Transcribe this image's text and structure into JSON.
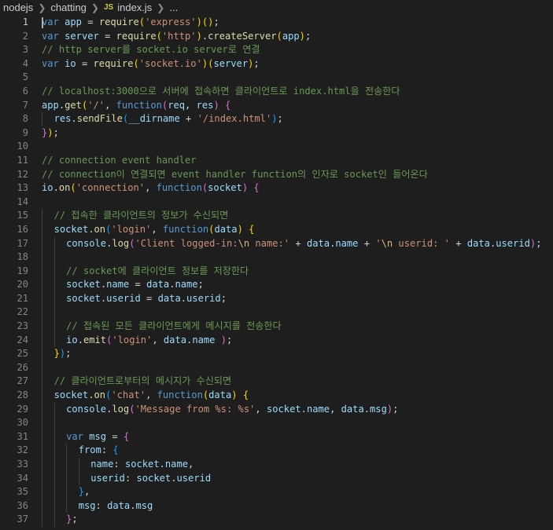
{
  "breadcrumb": {
    "items": [
      "nodejs",
      "chatting",
      "index.js",
      "..."
    ],
    "js_icon": "JS"
  },
  "colors": {
    "background": "#1e1e1e",
    "keyword": "#569cd6",
    "variable": "#9cdcfe",
    "function": "#dcdcaa",
    "string": "#ce9178",
    "comment": "#6a9955"
  },
  "editor": {
    "lines": [
      {
        "n": "1",
        "t": [
          [
            "k",
            "var"
          ],
          [
            "p",
            " "
          ],
          [
            "v",
            "app"
          ],
          [
            "p",
            " = "
          ],
          [
            "f",
            "require"
          ],
          [
            "bg",
            "("
          ],
          [
            "s",
            "'express'"
          ],
          [
            "bg",
            ")"
          ],
          [
            "bg",
            "("
          ],
          [
            "bg",
            ")"
          ],
          [
            "p",
            ";"
          ]
        ]
      },
      {
        "n": "2",
        "t": [
          [
            "k",
            "var"
          ],
          [
            "p",
            " "
          ],
          [
            "v",
            "server"
          ],
          [
            "p",
            " = "
          ],
          [
            "f",
            "require"
          ],
          [
            "bg",
            "("
          ],
          [
            "s",
            "'http'"
          ],
          [
            "bg",
            ")"
          ],
          [
            "p",
            "."
          ],
          [
            "f",
            "createServer"
          ],
          [
            "bg",
            "("
          ],
          [
            "v",
            "app"
          ],
          [
            "bg",
            ")"
          ],
          [
            "p",
            ";"
          ]
        ]
      },
      {
        "n": "3",
        "t": [
          [
            "c",
            "// http server를 socket.io server로 연결"
          ]
        ]
      },
      {
        "n": "4",
        "t": [
          [
            "k",
            "var"
          ],
          [
            "p",
            " "
          ],
          [
            "v",
            "io"
          ],
          [
            "p",
            " = "
          ],
          [
            "f",
            "require"
          ],
          [
            "bg",
            "("
          ],
          [
            "s",
            "'socket.io'"
          ],
          [
            "bg",
            ")"
          ],
          [
            "bg",
            "("
          ],
          [
            "v",
            "server"
          ],
          [
            "bg",
            ")"
          ],
          [
            "p",
            ";"
          ]
        ]
      },
      {
        "n": "5",
        "t": []
      },
      {
        "n": "6",
        "t": [
          [
            "c",
            "// localhost:3000으로 서버에 접속하면 클라이언트로 index.html을 전송한다"
          ]
        ]
      },
      {
        "n": "7",
        "t": [
          [
            "v",
            "app"
          ],
          [
            "p",
            "."
          ],
          [
            "f",
            "get"
          ],
          [
            "bg",
            "("
          ],
          [
            "s",
            "'/'"
          ],
          [
            "p",
            ", "
          ],
          [
            "k",
            "function"
          ],
          [
            "bp",
            "("
          ],
          [
            "v",
            "req"
          ],
          [
            "p",
            ", "
          ],
          [
            "v",
            "res"
          ],
          [
            "bp",
            ")"
          ],
          [
            "p",
            " "
          ],
          [
            "bp",
            "{"
          ]
        ]
      },
      {
        "n": "8",
        "i": 1,
        "t": [
          [
            "v",
            "res"
          ],
          [
            "p",
            "."
          ],
          [
            "f",
            "sendFile"
          ],
          [
            "bb",
            "("
          ],
          [
            "v",
            "__dirname"
          ],
          [
            "p",
            " + "
          ],
          [
            "s",
            "'/index.html'"
          ],
          [
            "bb",
            ")"
          ],
          [
            "p",
            ";"
          ]
        ]
      },
      {
        "n": "9",
        "t": [
          [
            "bp",
            "}"
          ],
          [
            "bg",
            ")"
          ],
          [
            "p",
            ";"
          ]
        ]
      },
      {
        "n": "10",
        "t": []
      },
      {
        "n": "11",
        "t": [
          [
            "c",
            "// connection event handler"
          ]
        ]
      },
      {
        "n": "12",
        "t": [
          [
            "c",
            "// connection이 연결되면 event handler function의 인자로 socket인 들어온다"
          ]
        ]
      },
      {
        "n": "13",
        "t": [
          [
            "v",
            "io"
          ],
          [
            "p",
            "."
          ],
          [
            "f",
            "on"
          ],
          [
            "bg",
            "("
          ],
          [
            "s",
            "'connection'"
          ],
          [
            "p",
            ", "
          ],
          [
            "k",
            "function"
          ],
          [
            "bp",
            "("
          ],
          [
            "v",
            "socket"
          ],
          [
            "bp",
            ")"
          ],
          [
            "p",
            " "
          ],
          [
            "bp",
            "{"
          ]
        ]
      },
      {
        "n": "14",
        "t": []
      },
      {
        "n": "15",
        "i": 1,
        "t": [
          [
            "c",
            "// 접속한 클라이언트의 정보가 수신되면"
          ]
        ]
      },
      {
        "n": "16",
        "i": 1,
        "t": [
          [
            "v",
            "socket"
          ],
          [
            "p",
            "."
          ],
          [
            "f",
            "on"
          ],
          [
            "bb",
            "("
          ],
          [
            "s",
            "'login'"
          ],
          [
            "p",
            ", "
          ],
          [
            "k",
            "function"
          ],
          [
            "bg",
            "("
          ],
          [
            "v",
            "data"
          ],
          [
            "bg",
            ")"
          ],
          [
            "p",
            " "
          ],
          [
            "bg",
            "{"
          ]
        ]
      },
      {
        "n": "17",
        "i": 2,
        "t": [
          [
            "v",
            "console"
          ],
          [
            "p",
            "."
          ],
          [
            "f",
            "log"
          ],
          [
            "bp",
            "("
          ],
          [
            "s",
            "'Client logged-in:"
          ],
          [
            "e",
            "\\n"
          ],
          [
            "s",
            " name:'"
          ],
          [
            "p",
            " + "
          ],
          [
            "v",
            "data"
          ],
          [
            "p",
            "."
          ],
          [
            "v",
            "name"
          ],
          [
            "p",
            " + "
          ],
          [
            "s",
            "'"
          ],
          [
            "e",
            "\\n"
          ],
          [
            "s",
            " userid: '"
          ],
          [
            "p",
            " + "
          ],
          [
            "v",
            "data"
          ],
          [
            "p",
            "."
          ],
          [
            "v",
            "userid"
          ],
          [
            "bp",
            ")"
          ],
          [
            "p",
            ";"
          ]
        ]
      },
      {
        "n": "18",
        "i": 2,
        "t": []
      },
      {
        "n": "19",
        "i": 2,
        "t": [
          [
            "c",
            "// socket에 클라이언트 정보를 저장한다"
          ]
        ]
      },
      {
        "n": "20",
        "i": 2,
        "t": [
          [
            "v",
            "socket"
          ],
          [
            "p",
            "."
          ],
          [
            "v",
            "name"
          ],
          [
            "p",
            " = "
          ],
          [
            "v",
            "data"
          ],
          [
            "p",
            "."
          ],
          [
            "v",
            "name"
          ],
          [
            "p",
            ";"
          ]
        ]
      },
      {
        "n": "21",
        "i": 2,
        "t": [
          [
            "v",
            "socket"
          ],
          [
            "p",
            "."
          ],
          [
            "v",
            "userid"
          ],
          [
            "p",
            " = "
          ],
          [
            "v",
            "data"
          ],
          [
            "p",
            "."
          ],
          [
            "v",
            "userid"
          ],
          [
            "p",
            ";"
          ]
        ]
      },
      {
        "n": "22",
        "i": 2,
        "t": []
      },
      {
        "n": "23",
        "i": 2,
        "t": [
          [
            "c",
            "// 접속된 모든 클라이언트에게 메시지를 전송한다"
          ]
        ]
      },
      {
        "n": "24",
        "i": 2,
        "t": [
          [
            "v",
            "io"
          ],
          [
            "p",
            "."
          ],
          [
            "f",
            "emit"
          ],
          [
            "bp",
            "("
          ],
          [
            "s",
            "'login'"
          ],
          [
            "p",
            ", "
          ],
          [
            "v",
            "data"
          ],
          [
            "p",
            "."
          ],
          [
            "v",
            "name"
          ],
          [
            "p",
            " "
          ],
          [
            "bp",
            ")"
          ],
          [
            "p",
            ";"
          ]
        ]
      },
      {
        "n": "25",
        "i": 1,
        "t": [
          [
            "bg",
            "}"
          ],
          [
            "bb",
            ")"
          ],
          [
            "p",
            ";"
          ]
        ]
      },
      {
        "n": "26",
        "i": 1,
        "t": []
      },
      {
        "n": "27",
        "i": 1,
        "t": [
          [
            "c",
            "// 클라이언트로부터의 메시지가 수신되면"
          ]
        ]
      },
      {
        "n": "28",
        "i": 1,
        "t": [
          [
            "v",
            "socket"
          ],
          [
            "p",
            "."
          ],
          [
            "f",
            "on"
          ],
          [
            "bb",
            "("
          ],
          [
            "s",
            "'chat'"
          ],
          [
            "p",
            ", "
          ],
          [
            "k",
            "function"
          ],
          [
            "bg",
            "("
          ],
          [
            "v",
            "data"
          ],
          [
            "bg",
            ")"
          ],
          [
            "p",
            " "
          ],
          [
            "bg",
            "{"
          ]
        ]
      },
      {
        "n": "29",
        "i": 2,
        "t": [
          [
            "v",
            "console"
          ],
          [
            "p",
            "."
          ],
          [
            "f",
            "log"
          ],
          [
            "bp",
            "("
          ],
          [
            "s",
            "'Message from %s: %s'"
          ],
          [
            "p",
            ", "
          ],
          [
            "v",
            "socket"
          ],
          [
            "p",
            "."
          ],
          [
            "v",
            "name"
          ],
          [
            "p",
            ", "
          ],
          [
            "v",
            "data"
          ],
          [
            "p",
            "."
          ],
          [
            "v",
            "msg"
          ],
          [
            "bp",
            ")"
          ],
          [
            "p",
            ";"
          ]
        ]
      },
      {
        "n": "30",
        "i": 2,
        "t": []
      },
      {
        "n": "31",
        "i": 2,
        "t": [
          [
            "k",
            "var"
          ],
          [
            "p",
            " "
          ],
          [
            "v",
            "msg"
          ],
          [
            "p",
            " = "
          ],
          [
            "bp",
            "{"
          ]
        ]
      },
      {
        "n": "32",
        "i": 3,
        "t": [
          [
            "v",
            "from"
          ],
          [
            "p",
            ": "
          ],
          [
            "bb",
            "{"
          ]
        ]
      },
      {
        "n": "33",
        "i": 4,
        "t": [
          [
            "v",
            "name"
          ],
          [
            "p",
            ": "
          ],
          [
            "v",
            "socket"
          ],
          [
            "p",
            "."
          ],
          [
            "v",
            "name"
          ],
          [
            "p",
            ","
          ]
        ]
      },
      {
        "n": "34",
        "i": 4,
        "t": [
          [
            "v",
            "userid"
          ],
          [
            "p",
            ": "
          ],
          [
            "v",
            "socket"
          ],
          [
            "p",
            "."
          ],
          [
            "v",
            "userid"
          ]
        ]
      },
      {
        "n": "35",
        "i": 3,
        "t": [
          [
            "bb",
            "}"
          ],
          [
            "p",
            ","
          ]
        ]
      },
      {
        "n": "36",
        "i": 3,
        "t": [
          [
            "v",
            "msg"
          ],
          [
            "p",
            ": "
          ],
          [
            "v",
            "data"
          ],
          [
            "p",
            "."
          ],
          [
            "v",
            "msg"
          ]
        ]
      },
      {
        "n": "37",
        "i": 2,
        "t": [
          [
            "bp",
            "}"
          ],
          [
            "p",
            ";"
          ]
        ]
      }
    ]
  }
}
